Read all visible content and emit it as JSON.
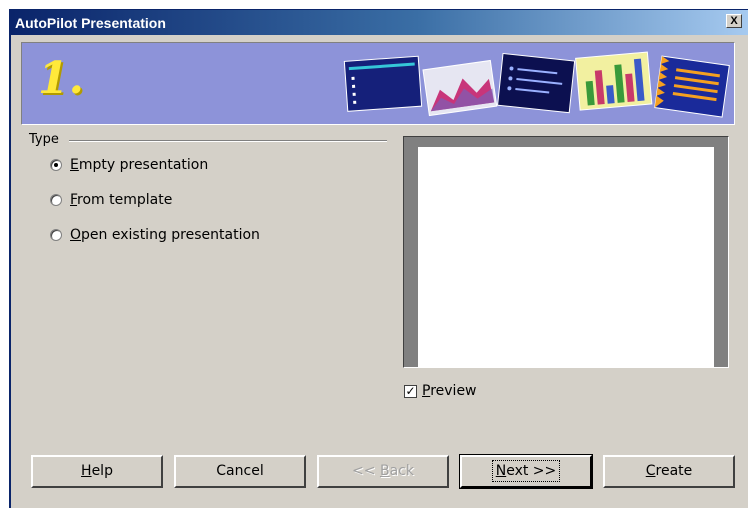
{
  "window": {
    "title": "AutoPilot Presentation",
    "close_glyph": "X"
  },
  "banner": {
    "step_number": "1."
  },
  "type_group": {
    "label": "Type",
    "options": [
      {
        "label_underline": "E",
        "label_rest": "mpty presentation",
        "checked": true
      },
      {
        "label_underline": "F",
        "label_rest": "rom template",
        "checked": false
      },
      {
        "label_underline": "O",
        "label_rest": "pen existing presentation",
        "checked": false
      }
    ]
  },
  "preview": {
    "checkbox_underline": "P",
    "checkbox_rest": "review",
    "checked": true,
    "check_glyph": "✓"
  },
  "buttons": {
    "help_u": "H",
    "help_rest": "elp",
    "cancel": "Cancel",
    "back_pre": "<< ",
    "back_u": "B",
    "back_rest": "ack",
    "next_u": "N",
    "next_rest": "ext >>",
    "create_u": "C",
    "create_rest": "reate"
  }
}
